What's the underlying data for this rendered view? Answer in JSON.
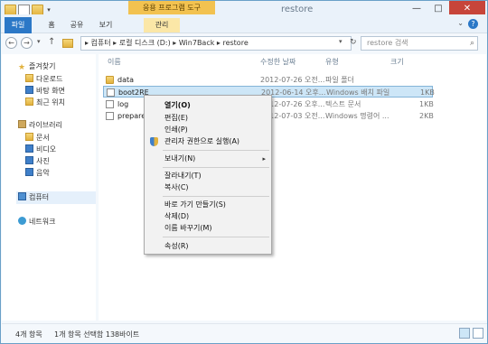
{
  "window": {
    "title": "restore",
    "contextual_group": "응용 프로그램 도구",
    "controls": [
      "—",
      "□",
      "✕"
    ]
  },
  "ribbon": {
    "tabs": [
      "파일",
      "홈",
      "공유",
      "보기",
      "관리"
    ],
    "help": "?"
  },
  "address": {
    "back": "←",
    "forward": "→",
    "up": "↑",
    "path": "▸ 컴퓨터 ▸ 로컬 디스크 (D:) ▸ Win7Back ▸ restore",
    "search_placeholder": "restore 검색"
  },
  "sidebar": {
    "favorites": "즐겨찾기",
    "fav_items": [
      "다운로드",
      "바탕 화면",
      "최근 위치"
    ],
    "libraries": "라이브러리",
    "lib_items": [
      "문서",
      "비디오",
      "사진",
      "음악"
    ],
    "computer": "컴퓨터",
    "network": "네트워크"
  },
  "columns": {
    "name": "이름",
    "date": "수정한 날짜",
    "type": "유형",
    "size": "크기"
  },
  "files": [
    {
      "name": "data",
      "date": "2012-07-26 오전...",
      "type": "파일 폴더",
      "size": ""
    },
    {
      "name": "boot2RE",
      "date": "2012-06-14 오후...",
      "type": "Windows 배치 파일",
      "size": "1KB"
    },
    {
      "name": "log",
      "date": "2012-07-26 오후...",
      "type": "텍스트 문서",
      "size": "1KB"
    },
    {
      "name": "prepare",
      "date": "2012-07-03 오전...",
      "type": "Windows 명령어 ...",
      "size": "2KB"
    }
  ],
  "context_menu": {
    "items": [
      "열기(O)",
      "편집(E)",
      "인쇄(P)",
      "관리자 권한으로 실행(A)",
      "보내기(N)",
      "잘라내기(T)",
      "복사(C)",
      "바로 가기 만들기(S)",
      "삭제(D)",
      "이름 바꾸기(M)",
      "속성(R)"
    ],
    "submenu_arrow": "▸"
  },
  "status": {
    "count": "4개 항목",
    "selection": "1개 항목 선택함 138바이트"
  },
  "colors": {
    "accent": "#2b78c7",
    "context_tab": "#f2c250",
    "selection": "#cde6f7",
    "close": "#c7453a"
  }
}
